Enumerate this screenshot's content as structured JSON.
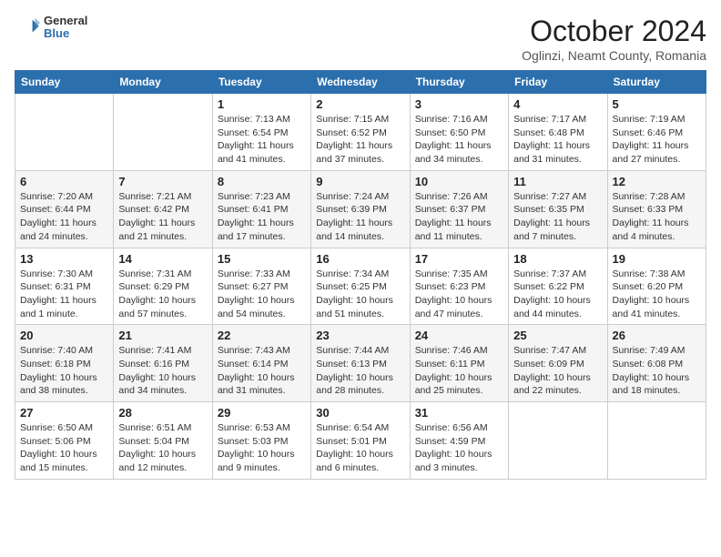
{
  "header": {
    "logo_general": "General",
    "logo_blue": "Blue",
    "month_title": "October 2024",
    "location": "Oglinzi, Neamt County, Romania"
  },
  "days_of_week": [
    "Sunday",
    "Monday",
    "Tuesday",
    "Wednesday",
    "Thursday",
    "Friday",
    "Saturday"
  ],
  "weeks": [
    [
      {
        "day": "",
        "info": ""
      },
      {
        "day": "",
        "info": ""
      },
      {
        "day": "1",
        "info": "Sunrise: 7:13 AM\nSunset: 6:54 PM\nDaylight: 11 hours and 41 minutes."
      },
      {
        "day": "2",
        "info": "Sunrise: 7:15 AM\nSunset: 6:52 PM\nDaylight: 11 hours and 37 minutes."
      },
      {
        "day": "3",
        "info": "Sunrise: 7:16 AM\nSunset: 6:50 PM\nDaylight: 11 hours and 34 minutes."
      },
      {
        "day": "4",
        "info": "Sunrise: 7:17 AM\nSunset: 6:48 PM\nDaylight: 11 hours and 31 minutes."
      },
      {
        "day": "5",
        "info": "Sunrise: 7:19 AM\nSunset: 6:46 PM\nDaylight: 11 hours and 27 minutes."
      }
    ],
    [
      {
        "day": "6",
        "info": "Sunrise: 7:20 AM\nSunset: 6:44 PM\nDaylight: 11 hours and 24 minutes."
      },
      {
        "day": "7",
        "info": "Sunrise: 7:21 AM\nSunset: 6:42 PM\nDaylight: 11 hours and 21 minutes."
      },
      {
        "day": "8",
        "info": "Sunrise: 7:23 AM\nSunset: 6:41 PM\nDaylight: 11 hours and 17 minutes."
      },
      {
        "day": "9",
        "info": "Sunrise: 7:24 AM\nSunset: 6:39 PM\nDaylight: 11 hours and 14 minutes."
      },
      {
        "day": "10",
        "info": "Sunrise: 7:26 AM\nSunset: 6:37 PM\nDaylight: 11 hours and 11 minutes."
      },
      {
        "day": "11",
        "info": "Sunrise: 7:27 AM\nSunset: 6:35 PM\nDaylight: 11 hours and 7 minutes."
      },
      {
        "day": "12",
        "info": "Sunrise: 7:28 AM\nSunset: 6:33 PM\nDaylight: 11 hours and 4 minutes."
      }
    ],
    [
      {
        "day": "13",
        "info": "Sunrise: 7:30 AM\nSunset: 6:31 PM\nDaylight: 11 hours and 1 minute."
      },
      {
        "day": "14",
        "info": "Sunrise: 7:31 AM\nSunset: 6:29 PM\nDaylight: 10 hours and 57 minutes."
      },
      {
        "day": "15",
        "info": "Sunrise: 7:33 AM\nSunset: 6:27 PM\nDaylight: 10 hours and 54 minutes."
      },
      {
        "day": "16",
        "info": "Sunrise: 7:34 AM\nSunset: 6:25 PM\nDaylight: 10 hours and 51 minutes."
      },
      {
        "day": "17",
        "info": "Sunrise: 7:35 AM\nSunset: 6:23 PM\nDaylight: 10 hours and 47 minutes."
      },
      {
        "day": "18",
        "info": "Sunrise: 7:37 AM\nSunset: 6:22 PM\nDaylight: 10 hours and 44 minutes."
      },
      {
        "day": "19",
        "info": "Sunrise: 7:38 AM\nSunset: 6:20 PM\nDaylight: 10 hours and 41 minutes."
      }
    ],
    [
      {
        "day": "20",
        "info": "Sunrise: 7:40 AM\nSunset: 6:18 PM\nDaylight: 10 hours and 38 minutes."
      },
      {
        "day": "21",
        "info": "Sunrise: 7:41 AM\nSunset: 6:16 PM\nDaylight: 10 hours and 34 minutes."
      },
      {
        "day": "22",
        "info": "Sunrise: 7:43 AM\nSunset: 6:14 PM\nDaylight: 10 hours and 31 minutes."
      },
      {
        "day": "23",
        "info": "Sunrise: 7:44 AM\nSunset: 6:13 PM\nDaylight: 10 hours and 28 minutes."
      },
      {
        "day": "24",
        "info": "Sunrise: 7:46 AM\nSunset: 6:11 PM\nDaylight: 10 hours and 25 minutes."
      },
      {
        "day": "25",
        "info": "Sunrise: 7:47 AM\nSunset: 6:09 PM\nDaylight: 10 hours and 22 minutes."
      },
      {
        "day": "26",
        "info": "Sunrise: 7:49 AM\nSunset: 6:08 PM\nDaylight: 10 hours and 18 minutes."
      }
    ],
    [
      {
        "day": "27",
        "info": "Sunrise: 6:50 AM\nSunset: 5:06 PM\nDaylight: 10 hours and 15 minutes."
      },
      {
        "day": "28",
        "info": "Sunrise: 6:51 AM\nSunset: 5:04 PM\nDaylight: 10 hours and 12 minutes."
      },
      {
        "day": "29",
        "info": "Sunrise: 6:53 AM\nSunset: 5:03 PM\nDaylight: 10 hours and 9 minutes."
      },
      {
        "day": "30",
        "info": "Sunrise: 6:54 AM\nSunset: 5:01 PM\nDaylight: 10 hours and 6 minutes."
      },
      {
        "day": "31",
        "info": "Sunrise: 6:56 AM\nSunset: 4:59 PM\nDaylight: 10 hours and 3 minutes."
      },
      {
        "day": "",
        "info": ""
      },
      {
        "day": "",
        "info": ""
      }
    ]
  ]
}
